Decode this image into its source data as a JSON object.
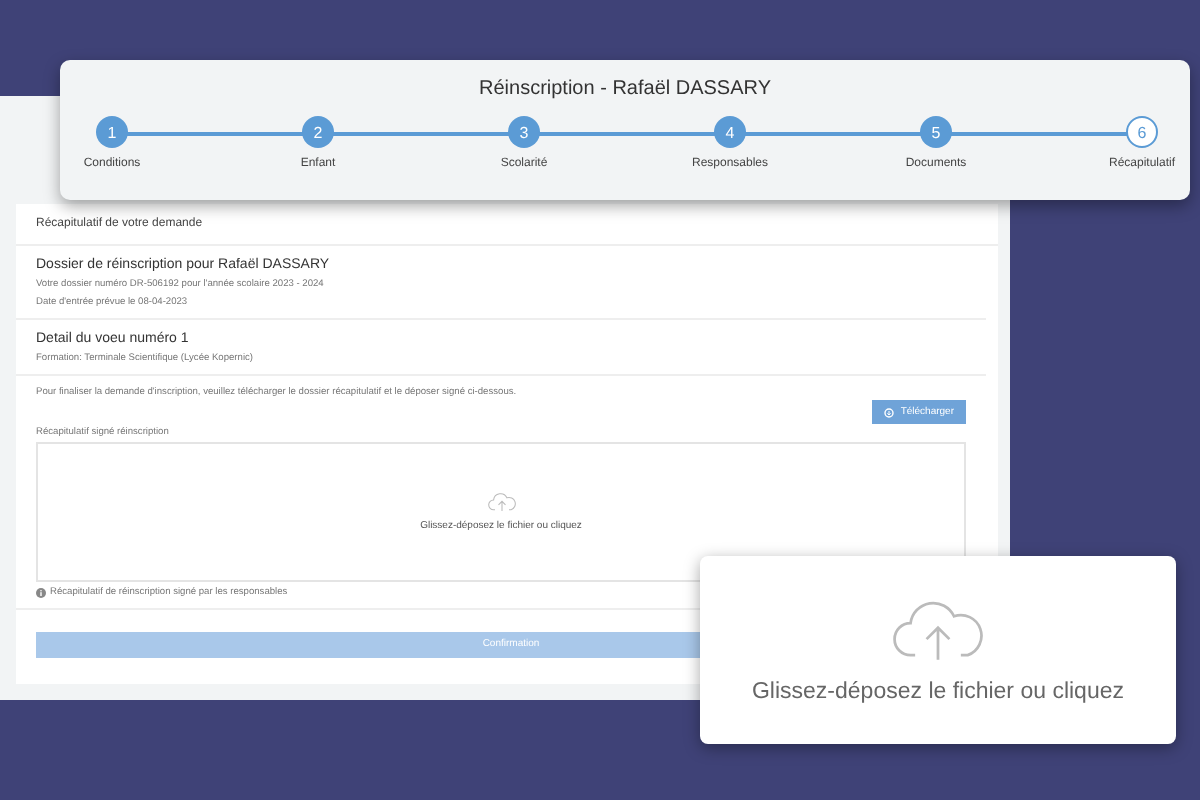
{
  "stepper": {
    "title": "Réinscription - Rafaël DASSARY",
    "steps": [
      {
        "number": "1",
        "label": "Conditions",
        "completed": true
      },
      {
        "number": "2",
        "label": "Enfant",
        "completed": true
      },
      {
        "number": "3",
        "label": "Scolarité",
        "completed": true
      },
      {
        "number": "4",
        "label": "Responsables",
        "completed": true
      },
      {
        "number": "5",
        "label": "Documents",
        "completed": true
      },
      {
        "number": "6",
        "label": "Récapitulatif",
        "completed": false
      }
    ]
  },
  "summary": {
    "header": "Récapitulatif de votre demande",
    "file_title": "Dossier de réinscription pour Rafaël DASSARY",
    "file_number": "Votre dossier numéro DR-506192 pour l'année scolaire 2023 - 2024",
    "entry_date": "Date d'entrée prévue le 08-04-2023",
    "wish_title": "Detail du voeu numéro 1",
    "wish_detail": "Formation: Terminale Scientifique (Lycée Kopernic)",
    "instructions": "Pour finaliser la demande d'inscription, veuillez télécharger le dossier récapitulatif et le déposer signé ci-dessous.",
    "download_button": "Télécharger",
    "upload_label": "Récapitulatif signé réinscription",
    "dropzone_text": "Glissez-déposez le fichier ou cliquez",
    "upload_hint": "Récapitulatif de réinscription signé par les responsables",
    "confirm_button": {
      "label": "Confirmation",
      "disabled": true
    }
  },
  "zoom_callout": {
    "dropzone_text": "Glissez-déposez le fichier ou cliquez"
  }
}
